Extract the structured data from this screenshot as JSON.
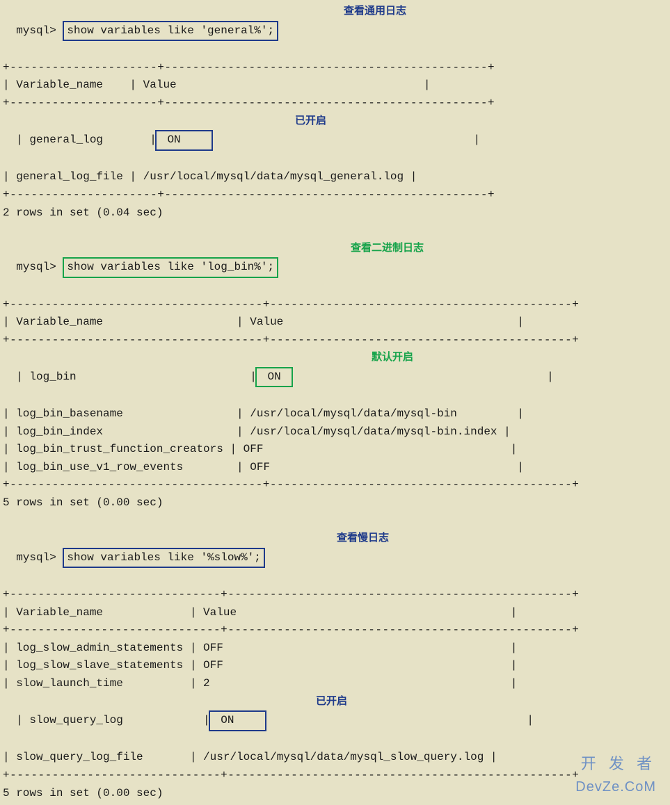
{
  "prompt": "mysql>",
  "section1": {
    "command": "show variables like 'general%';",
    "annotation": "查看通用日志",
    "border1": "+---------------------+----------------------------------------------+",
    "header": "| Variable_name    | Value                                     |",
    "row1_pre": "| general_log       |",
    "row1_val": " ON    ",
    "row1_post": "                                       |",
    "row1_annotation": "已开启",
    "row2": "| general_log_file | /usr/local/mysql/data/mysql_general.log |",
    "footer": "2 rows in set (0.04 sec)"
  },
  "section2": {
    "command": "show variables like 'log_bin%';",
    "annotation": "查看二进制日志",
    "border1": "+------------------------------------+-------------------------------------------+",
    "header": "| Variable_name                    | Value                                   |",
    "row1_pre": "| log_bin                          |",
    "row1_val": " ON ",
    "row1_post": "                                      |",
    "row1_annotation": "默认开启",
    "row2": "| log_bin_basename                 | /usr/local/mysql/data/mysql-bin         |",
    "row3": "| log_bin_index                    | /usr/local/mysql/data/mysql-bin.index |",
    "row4": "| log_bin_trust_function_creators | OFF                                     |",
    "row5": "| log_bin_use_v1_row_events        | OFF                                     |",
    "footer": "5 rows in set (0.00 sec)"
  },
  "section3": {
    "command": "show variables like '%slow%';",
    "annotation": "查看慢日志",
    "border1": "+------------------------------+-------------------------------------------------+",
    "header": "| Variable_name             | Value                                         |",
    "row1": "| log_slow_admin_statements | OFF                                           |",
    "row2": "| log_slow_slave_statements | OFF                                           |",
    "row3": "| slow_launch_time          | 2                                             |",
    "row4_pre": "| slow_query_log            |",
    "row4_val": " ON    ",
    "row4_post": "                                       |",
    "row4_annotation": "已开启",
    "row5": "| slow_query_log_file       | /usr/local/mysql/data/mysql_slow_query.log |",
    "footer": "5 rows in set (0.00 sec)"
  },
  "watermark": {
    "top": "开 发 者",
    "bottom": "DevZe.CoM"
  }
}
